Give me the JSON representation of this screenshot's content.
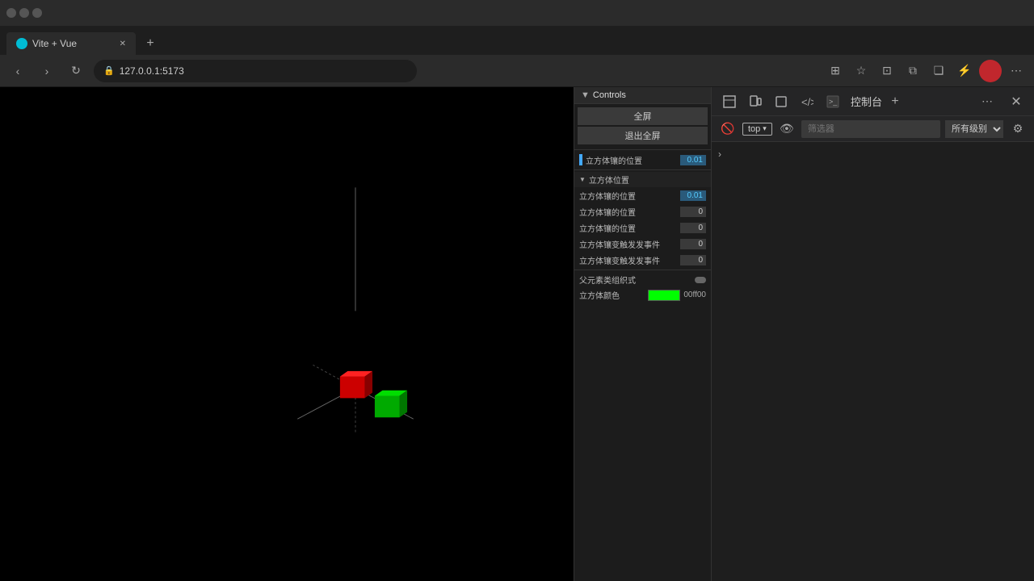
{
  "browser": {
    "tab_title": "Vite + Vue",
    "url": "127.0.0.1:5173",
    "favicon_color": "#00bcd4"
  },
  "devtools": {
    "title": "控制台",
    "top_label": "top",
    "filter_placeholder": "筛选器",
    "level_label": "所有级别",
    "close_label": "×",
    "add_label": "+"
  },
  "controls": {
    "header": "Controls",
    "btn_fullscreen": "全屏",
    "btn_exit_fullscreen": "退出全屏",
    "cube_pos_label": "立方体镶的位置",
    "cube_pos_value": "0.01",
    "section_cube_pos": "立方体位置",
    "rows": [
      {
        "label": "立方体镶的位置",
        "value": "0.01",
        "highlight": true
      },
      {
        "label": "立方体镶的位置",
        "value": "0",
        "highlight": false
      },
      {
        "label": "立方体镶的位置",
        "value": "0",
        "highlight": false
      },
      {
        "label": "立方体镶变触发发事件",
        "value": "0",
        "highlight": false
      },
      {
        "label": "立方体镶变触发发事件",
        "value": "0",
        "highlight": false
      }
    ],
    "toggle_label": "父元素类组织式",
    "color_label": "立方体颜色",
    "color_value": "00ff00",
    "color_hex": "#00ff00"
  }
}
